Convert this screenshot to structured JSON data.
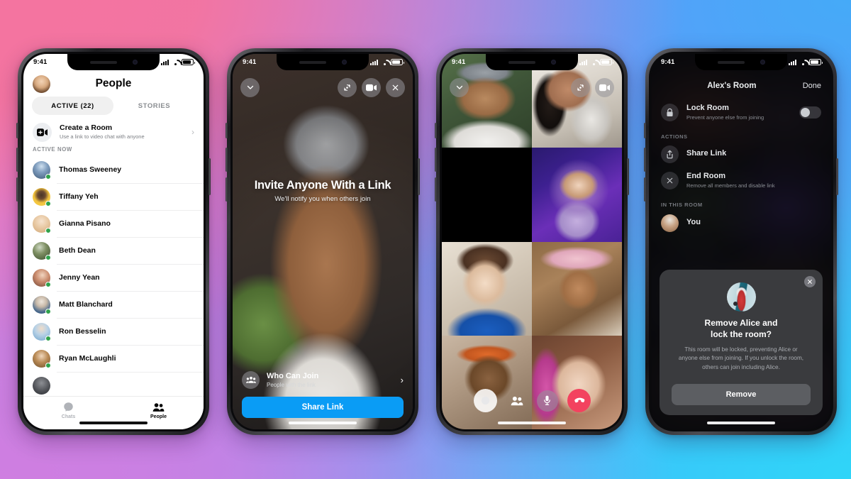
{
  "background": {
    "colors": {
      "top_left": "#f4749f",
      "top_right": "#45aaf8",
      "bottom_left": "#cf7ee1",
      "bottom_right": "#2fd5f8",
      "center": "#7b9cf2"
    }
  },
  "status_bar": {
    "time": "9:41"
  },
  "phone1": {
    "name": "people-list-screen",
    "header": {
      "title": "People",
      "avatar": "user-avatar"
    },
    "tabs": [
      {
        "label": "ACTIVE (22)",
        "active": true
      },
      {
        "label": "STORIES",
        "active": false
      }
    ],
    "create_room": {
      "title": "Create a Room",
      "subtitle": "Use a link to video chat with anyone",
      "icon": "video-camera-plus-icon",
      "chevron": "›"
    },
    "section_header": "ACTIVE NOW",
    "contacts": [
      {
        "name": "Thomas Sweeney",
        "online": true
      },
      {
        "name": "Tiffany Yeh",
        "online": true
      },
      {
        "name": "Gianna Pisano",
        "online": true
      },
      {
        "name": "Beth Dean",
        "online": true
      },
      {
        "name": "Jenny Yean",
        "online": true
      },
      {
        "name": "Matt Blanchard",
        "online": true
      },
      {
        "name": "Ron Besselin",
        "online": true
      },
      {
        "name": "Ryan McLaughli",
        "online": true
      }
    ],
    "tabbar": [
      {
        "label": "Chats",
        "icon": "chat-bubble-icon",
        "active": false
      },
      {
        "label": "People",
        "icon": "people-icon",
        "active": true
      }
    ],
    "online_color": "#31a24c"
  },
  "phone2": {
    "name": "invite-link-screen",
    "top_buttons": [
      {
        "icon": "chevron-down-icon"
      },
      {
        "icon": "camera-flip-icon"
      },
      {
        "icon": "video-camera-icon"
      },
      {
        "icon": "close-icon"
      }
    ],
    "headline": "Invite Anyone With a Link",
    "subtext": "We'll notify you when others join",
    "who_can_join": {
      "title": "Who Can Join",
      "subtitle": "People with the link",
      "icon": "people-group-icon",
      "chevron": "›"
    },
    "share_button": {
      "label": "Share Link",
      "color": "#0a9cf5"
    }
  },
  "phone3": {
    "name": "video-call-grid-screen",
    "top_buttons": [
      {
        "icon": "chevron-down-icon"
      },
      {
        "icon": "camera-flip-icon"
      },
      {
        "icon": "video-camera-icon"
      }
    ],
    "participant_count": 8,
    "controls": [
      {
        "icon": "effects-icon",
        "style": "white"
      },
      {
        "icon": "people-icon",
        "style": "plain"
      },
      {
        "icon": "microphone-icon",
        "style": "glass"
      },
      {
        "icon": "end-call-icon",
        "style": "red",
        "color": "#f3425f"
      }
    ]
  },
  "phone4": {
    "name": "room-settings-screen",
    "nav": {
      "title": "Alex's Room",
      "done": "Done"
    },
    "lock_room": {
      "title": "Lock Room",
      "subtitle": "Prevent anyone else from joining",
      "icon": "lock-icon",
      "toggle_on": false
    },
    "sections": [
      {
        "header": "ACTIONS"
      },
      {
        "header": "IN THIS ROOM"
      }
    ],
    "actions": [
      {
        "title": "Share Link",
        "subtitle": "",
        "icon": "share-icon"
      },
      {
        "title": "End Room",
        "subtitle": "Remove all members and disable link",
        "icon": "close-circle-icon"
      }
    ],
    "members": [
      {
        "name": "You",
        "avatar": "user-avatar"
      }
    ],
    "modal": {
      "name": "remove-and-lock-dialog",
      "close_icon": "close-icon",
      "illustration": "person-at-door-illustration",
      "title": "Remove Alice and lock the room?",
      "title_line1": "Remove Alice and",
      "title_line2": "lock the room?",
      "body": "This room will be locked, preventing Alice or anyone else from joining. If you unlock the room, others can join including Alice.",
      "primary_button": "Remove"
    }
  }
}
